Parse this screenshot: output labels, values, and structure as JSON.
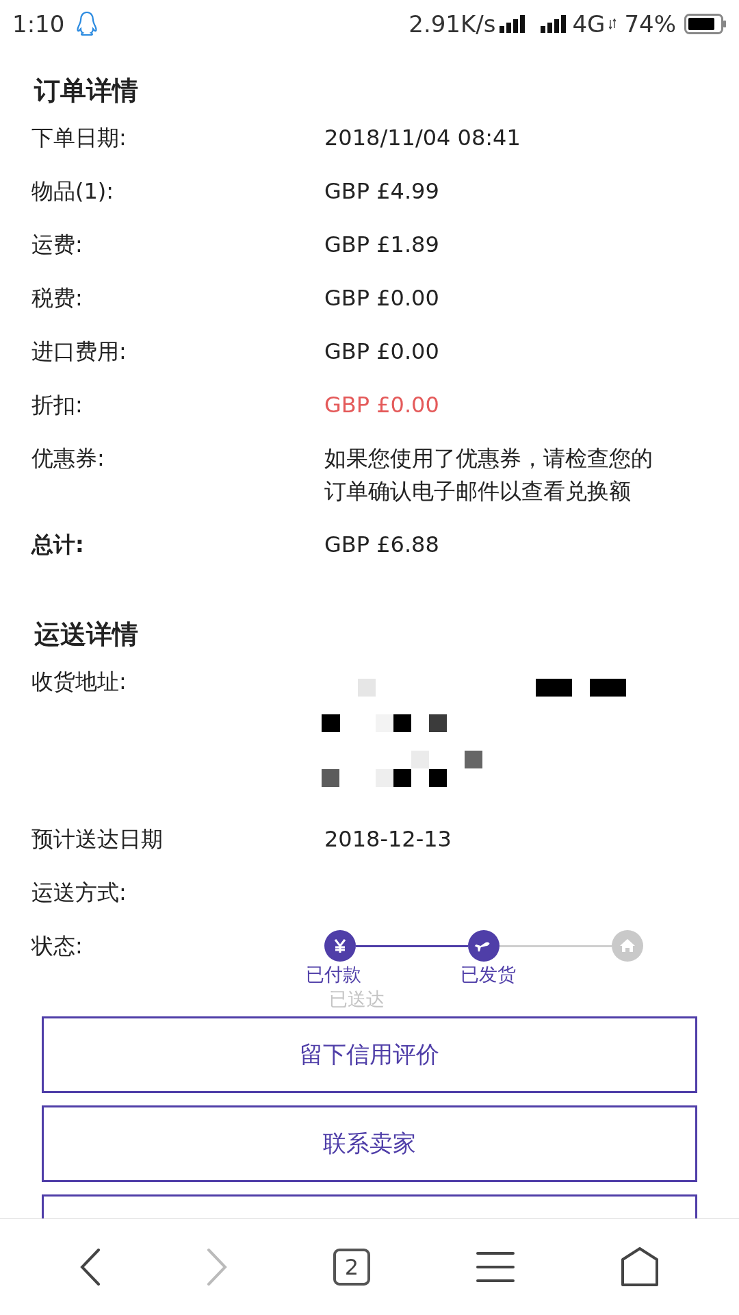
{
  "status_bar": {
    "time": "1:10",
    "speed": "2.91K/s",
    "network": "4G",
    "battery": "74%"
  },
  "order": {
    "title": "订单详情",
    "rows": [
      {
        "kind": "plain",
        "label": "下单日期:",
        "value": "2018/11/04 08:41"
      },
      {
        "kind": "plain",
        "label": "物品(1):",
        "value": "GBP £4.99"
      },
      {
        "kind": "plain",
        "label": "运费:",
        "value": "GBP £1.89"
      },
      {
        "kind": "plain",
        "label": "税费:",
        "value": "GBP £0.00"
      },
      {
        "kind": "plain",
        "label": "进口费用:",
        "value": "GBP £0.00"
      },
      {
        "kind": "discount",
        "label": "折扣:",
        "value": "GBP £0.00"
      },
      {
        "kind": "plain",
        "label": "优惠券:",
        "value": "如果您使用了优惠券，请检查您的订单确认电子邮件以查看兑换额"
      },
      {
        "kind": "total",
        "label": "总计:",
        "value": "GBP £6.88"
      }
    ]
  },
  "shipping": {
    "title": "运送详情",
    "rows": [
      {
        "kind": "redacted",
        "label": "收货地址:"
      },
      {
        "kind": "plain",
        "label": "预计送达日期",
        "value": "2018-12-13"
      },
      {
        "kind": "plain",
        "label": "运送方式:"
      }
    ],
    "status": {
      "label": "状态:",
      "steps": [
        {
          "label": "已付款",
          "done": true
        },
        {
          "label": "已发货",
          "done": true
        },
        {
          "label": "已送达",
          "done": false
        }
      ]
    }
  },
  "buttons": [
    {
      "label": "留下信用评价"
    },
    {
      "label": "联系卖家"
    }
  ],
  "more_buttons_below": true,
  "nav": {
    "forward_disabled": true,
    "tab_count": "2"
  }
}
